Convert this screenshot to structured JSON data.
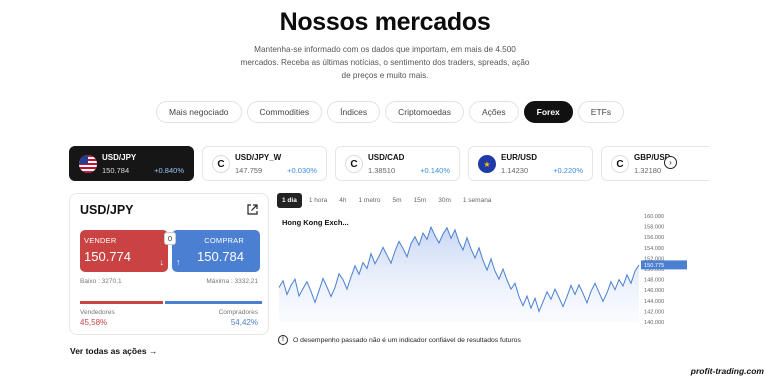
{
  "header": {
    "title": "Nossos mercados",
    "subtitle": "Mantenha-se informado com os dados que importam, em mais de 4.500 mercados. Receba as últimas notícias, o sentimento dos traders, spreads, ação de preços e muito mais."
  },
  "tabs": [
    {
      "label": "Mais negociado",
      "active": false
    },
    {
      "label": "Commodities",
      "active": false
    },
    {
      "label": "Índices",
      "active": false
    },
    {
      "label": "Criptomoedas",
      "active": false
    },
    {
      "label": "Ações",
      "active": false
    },
    {
      "label": "Forex",
      "active": true
    },
    {
      "label": "ETFs",
      "active": false
    }
  ],
  "tickers": [
    {
      "symbol": "USD/JPY",
      "price": "150.784",
      "change": "+0.840%",
      "icon": "us-flag-icon",
      "active": true
    },
    {
      "symbol": "USD/JPY_W",
      "price": "147.759",
      "change": "+0.030%",
      "icon": "c-logo-icon",
      "active": false
    },
    {
      "symbol": "USD/CAD",
      "price": "1.38510",
      "change": "+0.140%",
      "icon": "c-logo-icon",
      "active": false
    },
    {
      "symbol": "EUR/USD",
      "price": "1.14230",
      "change": "+0.220%",
      "icon": "eu-flag-icon",
      "active": false
    },
    {
      "symbol": "GBP/USD",
      "price": "1.32180",
      "change": "",
      "icon": "c-logo-icon",
      "active": false
    }
  ],
  "instrument": {
    "name": "USD/JPY",
    "sell_label": "VENDER",
    "sell_price": "150.774",
    "buy_label": "COMPRAR",
    "buy_price": "150.784",
    "spread": "0",
    "low": "Baixo : 3270,1",
    "high": "Máxima : 3332,21",
    "sellers_label": "Vendedores",
    "buyers_label": "Compradores",
    "sellers_pct": "45,58%",
    "buyers_pct": "54,42%",
    "sellers_fraction": 0.4558
  },
  "see_all": "Ver todas as ações  →",
  "periods": [
    {
      "label": "1 dia",
      "active": true
    },
    {
      "label": "1 hora",
      "active": false
    },
    {
      "label": "4h",
      "active": false
    },
    {
      "label": "1 metro",
      "active": false
    },
    {
      "label": "5m",
      "active": false
    },
    {
      "label": "15m",
      "active": false
    },
    {
      "label": "30m",
      "active": false
    },
    {
      "label": "1 semana",
      "active": false
    }
  ],
  "chart_title": "Hong Kong Exch...",
  "chart_data": {
    "type": "area",
    "ylim": [
      140,
      160
    ],
    "yticks": [
      "160.000",
      "158.000",
      "156.000",
      "154.000",
      "152.000",
      "150.000",
      "148.000",
      "146.000",
      "144.000",
      "142.000",
      "140.000"
    ],
    "current_value_label": "150.775",
    "values": [
      146.5,
      147.8,
      145.2,
      146.9,
      148.1,
      144.9,
      146.3,
      147.6,
      145.8,
      143.7,
      145.9,
      148.2,
      146.6,
      144.8,
      146.5,
      149.1,
      148.0,
      146.2,
      148.5,
      150.6,
      149.0,
      151.2,
      150.1,
      152.9,
      151.0,
      152.4,
      154.1,
      152.6,
      151.1,
      153.4,
      155.2,
      153.9,
      152.3,
      154.8,
      156.1,
      154.5,
      156.8,
      155.6,
      157.9,
      156.3,
      154.9,
      156.6,
      157.8,
      155.8,
      157.4,
      155.1,
      153.6,
      155.9,
      153.8,
      152.1,
      154.0,
      151.6,
      149.8,
      151.9,
      149.6,
      148.1,
      150.0,
      147.9,
      146.2,
      147.3,
      144.8,
      143.1,
      144.9,
      142.6,
      144.5,
      142.0,
      143.8,
      145.7,
      144.3,
      146.2,
      144.6,
      142.9,
      144.8,
      146.9,
      145.2,
      147.0,
      145.4,
      143.6,
      145.8,
      147.3,
      145.6,
      143.9,
      145.5,
      147.6,
      146.1,
      148.0,
      146.8,
      148.9,
      147.3,
      149.6,
      150.77
    ]
  },
  "disclaimer": "O desempenho passado não é um indicador confiável de resultados futuros",
  "watermark": "profit-trading.com"
}
